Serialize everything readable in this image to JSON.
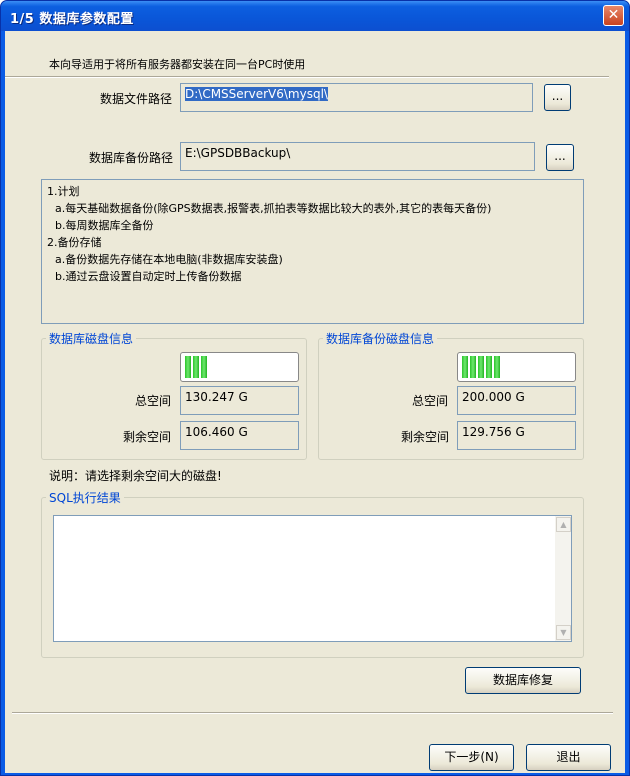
{
  "window": {
    "title": "1/5  数据库参数配置",
    "close_glyph": "✕"
  },
  "intro": "本向导适用于将所有服务器都安装在同一台PC时使用",
  "data_path": {
    "label": "数据文件路径",
    "value": "D:\\CMSServerV6\\mysql\\",
    "browse": "..."
  },
  "backup_path": {
    "label": "数据库备份路径",
    "value": "E:\\GPSDBBackup\\",
    "browse": "..."
  },
  "plan": [
    "1.计划",
    "  a.每天基础数据备份(除GPS数据表,报警表,抓拍表等数据比较大的表外,其它的表每天备份)",
    "  b.每周数据库全备份",
    "2.备份存储",
    "  a.备份数据先存储在本地电脑(非数据库安装盘)",
    "  b.通过云盘设置自动定时上传备份数据"
  ],
  "db_disk": {
    "title": "数据库磁盘信息",
    "total_label": "总空间",
    "total": "130.247 G",
    "free_label": "剩余空间",
    "free": "106.460 G",
    "usage_blocks": 3
  },
  "backup_disk": {
    "title": "数据库备份磁盘信息",
    "total_label": "总空间",
    "total": "200.000 G",
    "free_label": "剩余空间",
    "free": "129.756 G",
    "usage_blocks": 5
  },
  "note": "说明：请选择剩余空间大的磁盘!",
  "sql_result": {
    "title": "SQL执行结果"
  },
  "repair_button": "数据库修复",
  "next_button": "下一步(N)",
  "exit_button": "退出",
  "colors": {
    "title_bar": "#0a56d8",
    "client_bg": "#ece9d8",
    "group_label": "#0046d5",
    "progress_fill": "#2bc42b"
  }
}
